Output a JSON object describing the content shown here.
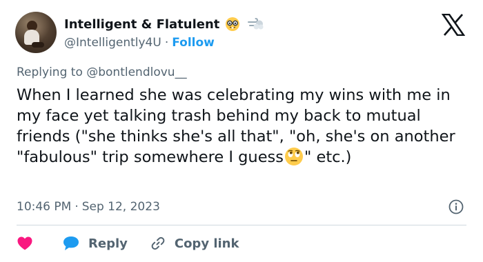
{
  "author": {
    "display_name": "Intelligent & Flatulent",
    "handle": "@Intelligently4U",
    "separator": "·",
    "follow_label": "Follow"
  },
  "icons": {
    "avatar": "avatar-photo",
    "name_emoji_1": "nerd-face-emoji",
    "name_emoji_2": "dashing-away-emoji",
    "brand": "x-logo-icon",
    "text_emoji": "face-with-rolling-eyes-emoji",
    "info": "info-icon",
    "like": "heart-icon",
    "reply": "speech-bubble-icon",
    "copy": "link-icon"
  },
  "reply_to": "Replying to @bontlendlovu__",
  "tweet": {
    "text_before_emoji": "When I learned she was celebrating my wins with me in my face yet talking trash behind my back to mutual friends (\"she thinks she's all that\", \"oh, she's on another \"fabulous\" trip somewhere I guess",
    "text_after_emoji": "\" etc.)"
  },
  "meta": {
    "time": "10:46 PM",
    "separator": "·",
    "date": "Sep 12, 2023"
  },
  "actions": {
    "reply_label": "Reply",
    "copy_link_label": "Copy link"
  },
  "colors": {
    "text": "#0f1419",
    "secondary": "#536471",
    "accent": "#1d9bf0",
    "heart": "#f91880",
    "divider": "#cfd9de"
  }
}
